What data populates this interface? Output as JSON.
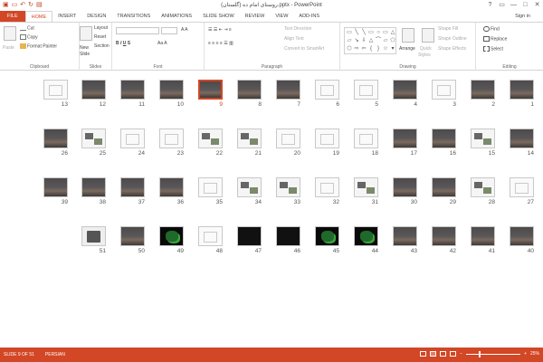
{
  "window": {
    "title": "(گلستان) روستای امام ده.pptx - PowerPoint"
  },
  "qat": {
    "save_icon": "save-icon",
    "undo_icon": "undo-icon",
    "redo_icon": "redo-icon",
    "start_icon": "present-icon"
  },
  "window_controls": {
    "help": "?",
    "restore": "▭",
    "minimize": "—",
    "maximize": "□",
    "close": "✕"
  },
  "tabs": [
    "FILE",
    "HOME",
    "INSERT",
    "DESIGN",
    "TRANSITIONS",
    "ANIMATIONS",
    "SLIDE SHOW",
    "REVIEW",
    "VIEW",
    "ADD-INS"
  ],
  "signin": "Sign in",
  "ribbon": {
    "clipboard": {
      "label": "Clipboard",
      "paste": "Paste",
      "cut": "Cut",
      "copy": "Copy",
      "format_painter": "Format Painter"
    },
    "slides": {
      "label": "Slides",
      "new_slide": "New",
      "new_slide2": "Slide",
      "layout": "Layout",
      "reset": "Reset",
      "section": "Section"
    },
    "font": {
      "label": "Font"
    },
    "paragraph": {
      "label": "Paragraph",
      "text_direction": "Text Direction",
      "align_text": "Align Text",
      "convert": "Convert to SmartArt"
    },
    "drawing": {
      "label": "Drawing",
      "arrange": "Arrange",
      "quick": "Quick",
      "styles": "Styles",
      "shape_fill": "Shape Fill",
      "shape_outline": "Shape Outline",
      "shape_effects": "Shape Effects"
    },
    "editing": {
      "label": "Editing",
      "find": "Find",
      "replace": "Replace",
      "select": "Select"
    }
  },
  "slides": [
    {
      "n": "1",
      "t": "photo"
    },
    {
      "n": "2",
      "t": "photo"
    },
    {
      "n": "3",
      "t": "white"
    },
    {
      "n": "4",
      "t": "photo"
    },
    {
      "n": "5",
      "t": "white"
    },
    {
      "n": "6",
      "t": "white"
    },
    {
      "n": "7",
      "t": "photo"
    },
    {
      "n": "8",
      "t": "photo"
    },
    {
      "n": "9",
      "t": "photo"
    },
    {
      "n": "10",
      "t": "photo"
    },
    {
      "n": "11",
      "t": "photo"
    },
    {
      "n": "12",
      "t": "photo"
    },
    {
      "n": "13",
      "t": "white"
    },
    {
      "n": "14",
      "t": "photo"
    },
    {
      "n": "15",
      "t": "images"
    },
    {
      "n": "16",
      "t": "photo"
    },
    {
      "n": "17",
      "t": "photo"
    },
    {
      "n": "18",
      "t": "white"
    },
    {
      "n": "19",
      "t": "white"
    },
    {
      "n": "20",
      "t": "white"
    },
    {
      "n": "21",
      "t": "images"
    },
    {
      "n": "22",
      "t": "images"
    },
    {
      "n": "23",
      "t": "white"
    },
    {
      "n": "24",
      "t": "white"
    },
    {
      "n": "25",
      "t": "images"
    },
    {
      "n": "26",
      "t": "photo"
    },
    {
      "n": "27",
      "t": "white"
    },
    {
      "n": "28",
      "t": "images"
    },
    {
      "n": "29",
      "t": "photo"
    },
    {
      "n": "30",
      "t": "photo"
    },
    {
      "n": "31",
      "t": "images"
    },
    {
      "n": "32",
      "t": "white"
    },
    {
      "n": "33",
      "t": "images"
    },
    {
      "n": "34",
      "t": "images"
    },
    {
      "n": "35",
      "t": "white"
    },
    {
      "n": "36",
      "t": "photo"
    },
    {
      "n": "37",
      "t": "photo"
    },
    {
      "n": "38",
      "t": "photo"
    },
    {
      "n": "39",
      "t": "photo"
    },
    {
      "n": "40",
      "t": "photo"
    },
    {
      "n": "41",
      "t": "photo"
    },
    {
      "n": "42",
      "t": "photo"
    },
    {
      "n": "43",
      "t": "photo"
    },
    {
      "n": "44",
      "t": "darkmap"
    },
    {
      "n": "45",
      "t": "darkmap"
    },
    {
      "n": "46",
      "t": "dark"
    },
    {
      "n": "47",
      "t": "dark"
    },
    {
      "n": "48",
      "t": "white"
    },
    {
      "n": "49",
      "t": "darkmap"
    },
    {
      "n": "50",
      "t": "photo"
    },
    {
      "n": "51",
      "t": "device"
    }
  ],
  "active_slide": "9",
  "status": {
    "slide_info": "SLIDE 9 OF 51",
    "language": "PERSIAN",
    "zoom": "25%",
    "zoom_minus": "−",
    "zoom_plus": "+"
  },
  "colors": {
    "accent": "#d24726"
  }
}
